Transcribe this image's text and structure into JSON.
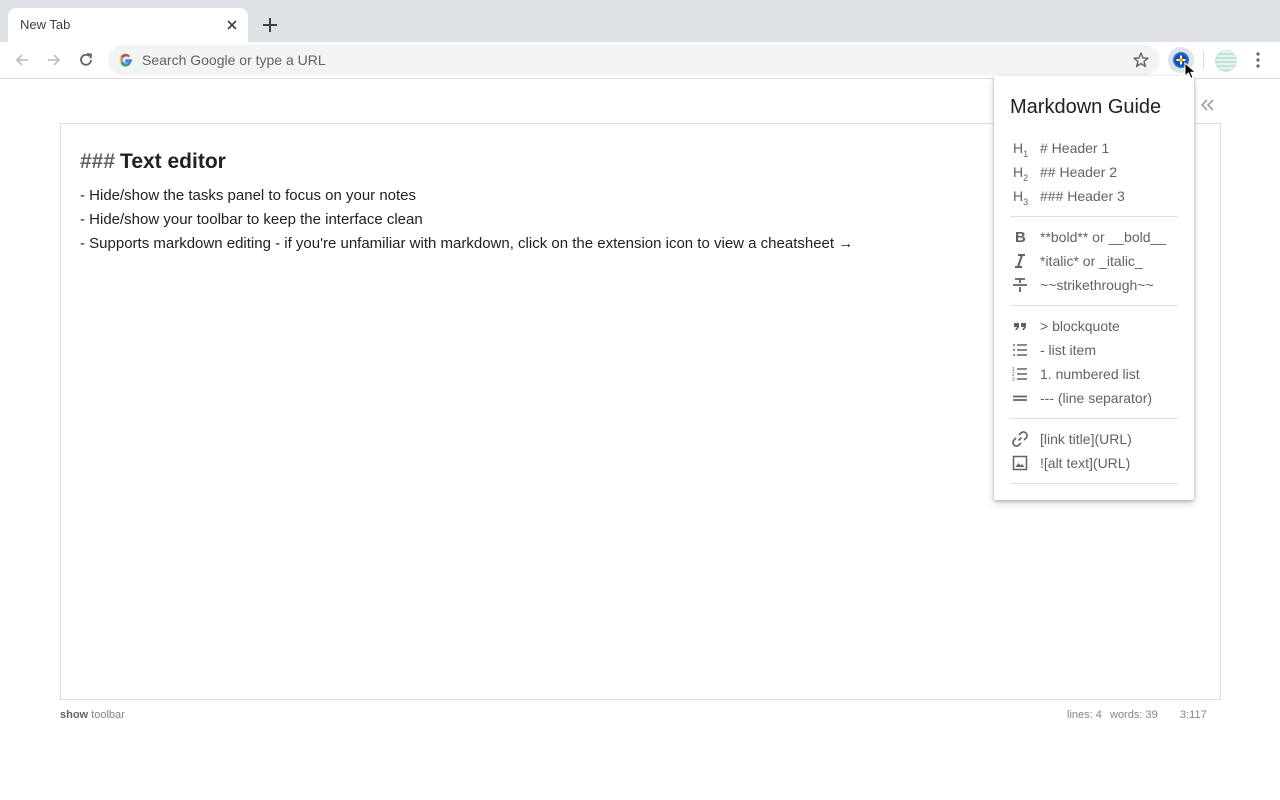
{
  "tab": {
    "title": "New Tab"
  },
  "omnibox": {
    "placeholder": "Search Google or type a URL"
  },
  "editor": {
    "heading_hash": "###",
    "heading_text": "Text editor",
    "lines": [
      "- Hide/show the tasks panel to focus on your notes",
      "- Hide/show your toolbar to keep the interface clean",
      "- Supports markdown editing - if you're unfamiliar with markdown, click on the extension icon to view a cheatsheet →"
    ]
  },
  "footer": {
    "show": "show",
    "toolbar": "toolbar",
    "lines": "lines: 4",
    "words": "words: 39",
    "position": "3:117"
  },
  "guide": {
    "title": "Markdown Guide",
    "headers": [
      {
        "icon_letter": "H",
        "icon_sub": "1",
        "label": "# Header 1"
      },
      {
        "icon_letter": "H",
        "icon_sub": "2",
        "label": "## Header 2"
      },
      {
        "icon_letter": "H",
        "icon_sub": "3",
        "label": "### Header 3"
      }
    ],
    "format": [
      {
        "icon": "bold-icon",
        "label": "**bold** or __bold__"
      },
      {
        "icon": "italic-icon",
        "label": "*italic* or _italic_"
      },
      {
        "icon": "strikethrough-icon",
        "label": "~~strikethrough~~"
      }
    ],
    "blocks": [
      {
        "icon": "quote-icon",
        "label": "> blockquote"
      },
      {
        "icon": "list-icon",
        "label": "- list item"
      },
      {
        "icon": "numbered-list-icon",
        "label": "1. numbered list"
      },
      {
        "icon": "separator-icon",
        "label": "--- (line separator)"
      }
    ],
    "media": [
      {
        "icon": "link-icon",
        "label": "[link title](URL)"
      },
      {
        "icon": "image-icon",
        "label": "![alt text](URL)"
      }
    ]
  },
  "colors": {
    "accent_ext": "#1a73e8",
    "text": "#202124",
    "muted": "#5f6368"
  }
}
